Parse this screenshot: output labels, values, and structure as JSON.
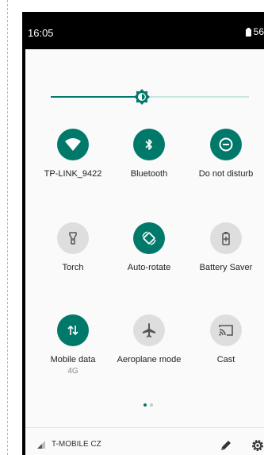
{
  "status": {
    "time": "16:05",
    "battery": "56"
  },
  "brightness": {
    "level": 0.46
  },
  "tiles": [
    {
      "label": "TP-LINK_9422",
      "sub": "",
      "active": true,
      "icon": "wifi-icon"
    },
    {
      "label": "Bluetooth",
      "sub": "",
      "active": true,
      "icon": "bluetooth-icon"
    },
    {
      "label": "Do not disturb",
      "sub": "",
      "active": true,
      "icon": "do-not-disturb-icon"
    },
    {
      "label": "Torch",
      "sub": "",
      "active": false,
      "icon": "torch-icon"
    },
    {
      "label": "Auto-rotate",
      "sub": "",
      "active": true,
      "icon": "auto-rotate-icon"
    },
    {
      "label": "Battery Saver",
      "sub": "",
      "active": false,
      "icon": "battery-saver-icon"
    },
    {
      "label": "Mobile data",
      "sub": "4G",
      "active": true,
      "icon": "mobile-data-icon"
    },
    {
      "label": "Aeroplane mode",
      "sub": "",
      "active": false,
      "icon": "aeroplane-icon"
    },
    {
      "label": "Cast",
      "sub": "",
      "active": false,
      "icon": "cast-icon"
    }
  ],
  "pager": {
    "current": 1,
    "total": 2
  },
  "footer": {
    "carrier": "T-MOBILE CZ"
  },
  "colors": {
    "accent": "#00796b",
    "inactive": "#dedede",
    "track": "#c7e6e2"
  }
}
